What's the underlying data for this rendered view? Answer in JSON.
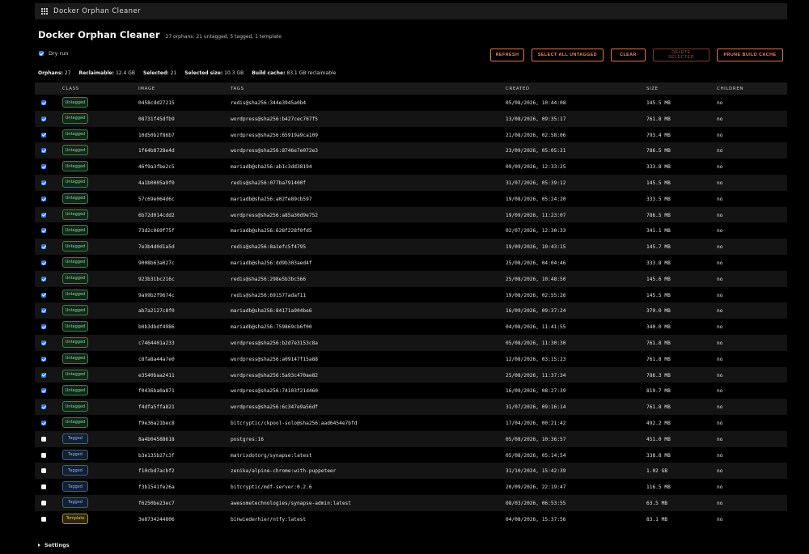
{
  "window": {
    "title": "Docker Orphan Cleaner",
    "icon": "grid-icon"
  },
  "header": {
    "title": "Docker Orphan Cleaner",
    "subtitle": "27 orphans: 21 untagged, 5 tagged, 1 template"
  },
  "dry_run": {
    "label": "Dry run",
    "checked": true
  },
  "buttons": {
    "refresh": "REFRESH",
    "select_all_untagged": "SELECT ALL UNTAGGED",
    "clear": "CLEAR",
    "delete_selected": "DELETE SELECTED",
    "prune_build_cache": "PRUNE BUILD CACHE"
  },
  "stats": {
    "orphans_label": "Orphans:",
    "orphans_value": "27",
    "reclaimable_label": "Reclaimable:",
    "reclaimable_value": "12.4 GB",
    "selected_label": "Selected:",
    "selected_value": "21",
    "selected_size_label": "Selected size:",
    "selected_size_value": "10.3 GB",
    "build_cache_label": "Build cache:",
    "build_cache_value": "83.1 GB reclaimable"
  },
  "table": {
    "columns": {
      "class": "CLASS",
      "image": "IMAGE",
      "tags": "TAGS",
      "created": "CREATED",
      "size": "SIZE",
      "children": "CHILDREN"
    },
    "rows": [
      {
        "checked": true,
        "class": "Untagged",
        "image": "0458cdd27215",
        "tags": "redis@sha256:344e3945a0b4",
        "created": "05/08/2026, 10:44:08",
        "size": "145.5 MB",
        "children": "no"
      },
      {
        "checked": true,
        "class": "Untagged",
        "image": "08731f45dfb9",
        "tags": "wordpress@sha256:b427cec767f5",
        "created": "13/08/2026, 09:35:17",
        "size": "761.8 MB",
        "children": "no"
      },
      {
        "checked": true,
        "class": "Untagged",
        "image": "10d50b2f86b7",
        "tags": "wordpress@sha256:65919a9ca109",
        "created": "21/08/2026, 02:58:06",
        "size": "793.4 MB",
        "children": "no"
      },
      {
        "checked": true,
        "class": "Untagged",
        "image": "1f64b8728e4d",
        "tags": "wordpress@sha256:8746e7e072e3",
        "created": "23/09/2026, 05:05:21",
        "size": "786.5 MB",
        "children": "no"
      },
      {
        "checked": true,
        "class": "Untagged",
        "image": "46f9a3fbe2c5",
        "tags": "mariadb@sha256:ab1c3dd38194",
        "created": "09/09/2026, 12:33:25",
        "size": "333.8 MB",
        "children": "no"
      },
      {
        "checked": true,
        "class": "Untagged",
        "image": "4a1b0005a9f0",
        "tags": "redis@sha256:077ba791400f",
        "created": "31/07/2026, 05:39:12",
        "size": "145.5 MB",
        "children": "no"
      },
      {
        "checked": true,
        "class": "Untagged",
        "image": "57c69e064d6c",
        "tags": "mariadb@sha256:a02fe89cb597",
        "created": "19/08/2026, 05:24:20",
        "size": "333.5 MB",
        "children": "no"
      },
      {
        "checked": true,
        "class": "Untagged",
        "image": "6b72d014cdd2",
        "tags": "wordpress@sha256:a85a30d9e752",
        "created": "19/09/2026, 11:23:07",
        "size": "786.5 MB",
        "children": "no"
      },
      {
        "checked": true,
        "class": "Untagged",
        "image": "73d2c069f75f",
        "tags": "mariadb@sha256:628f228f0fd5",
        "created": "02/07/2026, 12:30:33",
        "size": "341.1 MB",
        "children": "no"
      },
      {
        "checked": true,
        "class": "Untagged",
        "image": "7e3b4d0d1a5d",
        "tags": "redis@sha256:8a1efc5f4795",
        "created": "19/09/2026, 10:43:15",
        "size": "145.7 MB",
        "children": "no"
      },
      {
        "checked": true,
        "class": "Untagged",
        "image": "9008b63a027c",
        "tags": "mariadb@sha256:dd9b303aed4f",
        "created": "25/08/2026, 04:04:46",
        "size": "333.8 MB",
        "children": "no"
      },
      {
        "checked": true,
        "class": "Untagged",
        "image": "923b31bc216c",
        "tags": "redis@sha256:298e5b3bc566",
        "created": "25/08/2026, 10:48:50",
        "size": "145.6 MB",
        "children": "no"
      },
      {
        "checked": true,
        "class": "Untagged",
        "image": "9a99b2f9674c",
        "tags": "redis@sha256:691577adaf11",
        "created": "19/08/2026, 02:55:26",
        "size": "145.5 MB",
        "children": "no"
      },
      {
        "checked": true,
        "class": "Untagged",
        "image": "ab7a2127c8f0",
        "tags": "mariadb@sha256:84171a904be6",
        "created": "16/09/2026, 09:37:24",
        "size": "370.0 MB",
        "children": "no"
      },
      {
        "checked": true,
        "class": "Untagged",
        "image": "b0b3dbdf4986",
        "tags": "mariadb@sha256:759869cb6f00",
        "created": "04/08/2026, 11:41:55",
        "size": "340.0 MB",
        "children": "no"
      },
      {
        "checked": true,
        "class": "Untagged",
        "image": "c7464401a233",
        "tags": "wordpress@sha256:b2d7e3153c8a",
        "created": "05/08/2026, 11:30:30",
        "size": "761.8 MB",
        "children": "no"
      },
      {
        "checked": true,
        "class": "Untagged",
        "image": "c8fa8a44a7e0",
        "tags": "wordpress@sha256:a09147f15a88",
        "created": "12/08/2026, 03:15:23",
        "size": "761.8 MB",
        "children": "no"
      },
      {
        "checked": true,
        "class": "Untagged",
        "image": "e3540baa2411",
        "tags": "wordpress@sha256:5a93c470ae82",
        "created": "25/08/2026, 11:37:34",
        "size": "786.3 MB",
        "children": "no"
      },
      {
        "checked": true,
        "class": "Untagged",
        "image": "f0436ba0a871",
        "tags": "wordpress@sha256:74103f21d460",
        "created": "16/09/2026, 08:27:39",
        "size": "819.7 MB",
        "children": "no"
      },
      {
        "checked": true,
        "class": "Untagged",
        "image": "f4dfa5ffa821",
        "tags": "wordpress@sha256:6c347e9a56df",
        "created": "31/07/2026, 09:16:14",
        "size": "761.8 MB",
        "children": "no"
      },
      {
        "checked": true,
        "class": "Untagged",
        "image": "f9e36a21bec8",
        "tags": "bitcryptic/ckpool-solo@sha256:aad6454e7bfd",
        "created": "17/04/2026, 00:21:42",
        "size": "492.2 MB",
        "children": "no"
      },
      {
        "checked": false,
        "class": "Tagged",
        "image": "8a4b04588618",
        "tags": "postgres:16",
        "created": "05/08/2026, 10:36:57",
        "size": "451.0 MB",
        "children": "no"
      },
      {
        "checked": false,
        "class": "Tagged",
        "image": "b3e135b27c3f",
        "tags": "matrixdotorg/synapse:latest",
        "created": "05/08/2026, 05:14:54",
        "size": "338.8 MB",
        "children": "no"
      },
      {
        "checked": false,
        "class": "Tagged",
        "image": "f10cbd7acbf2",
        "tags": "zenika/alpine-chrome:with-puppeteer",
        "created": "31/10/2024, 15:42:39",
        "size": "1.02 GB",
        "children": "no"
      },
      {
        "checked": false,
        "class": "Tagged",
        "image": "f3b1541fe26a",
        "tags": "bitcryptic/mdf-server:0.2.6",
        "created": "20/09/2026, 22:19:47",
        "size": "116.5 MB",
        "children": "no"
      },
      {
        "checked": false,
        "class": "Tagged",
        "image": "f6250be23ec7",
        "tags": "awesometechnologies/synapse-admin:latest",
        "created": "08/03/2026, 06:53:55",
        "size": "63.5 MB",
        "children": "no"
      },
      {
        "checked": false,
        "class": "Template",
        "image": "3e8734244806",
        "tags": "binwiederhier/ntfy:latest",
        "created": "04/08/2026, 15:37:56",
        "size": "83.1 MB",
        "children": "no"
      }
    ]
  },
  "settings": {
    "label": "Settings",
    "icon": "triangle-right-icon"
  },
  "colors": {
    "accent": "#f08a5d",
    "checkbox": "#2f7be6",
    "untagged": "#8fd19a",
    "tagged": "#8fb2e6",
    "template": "#e2c84c"
  }
}
